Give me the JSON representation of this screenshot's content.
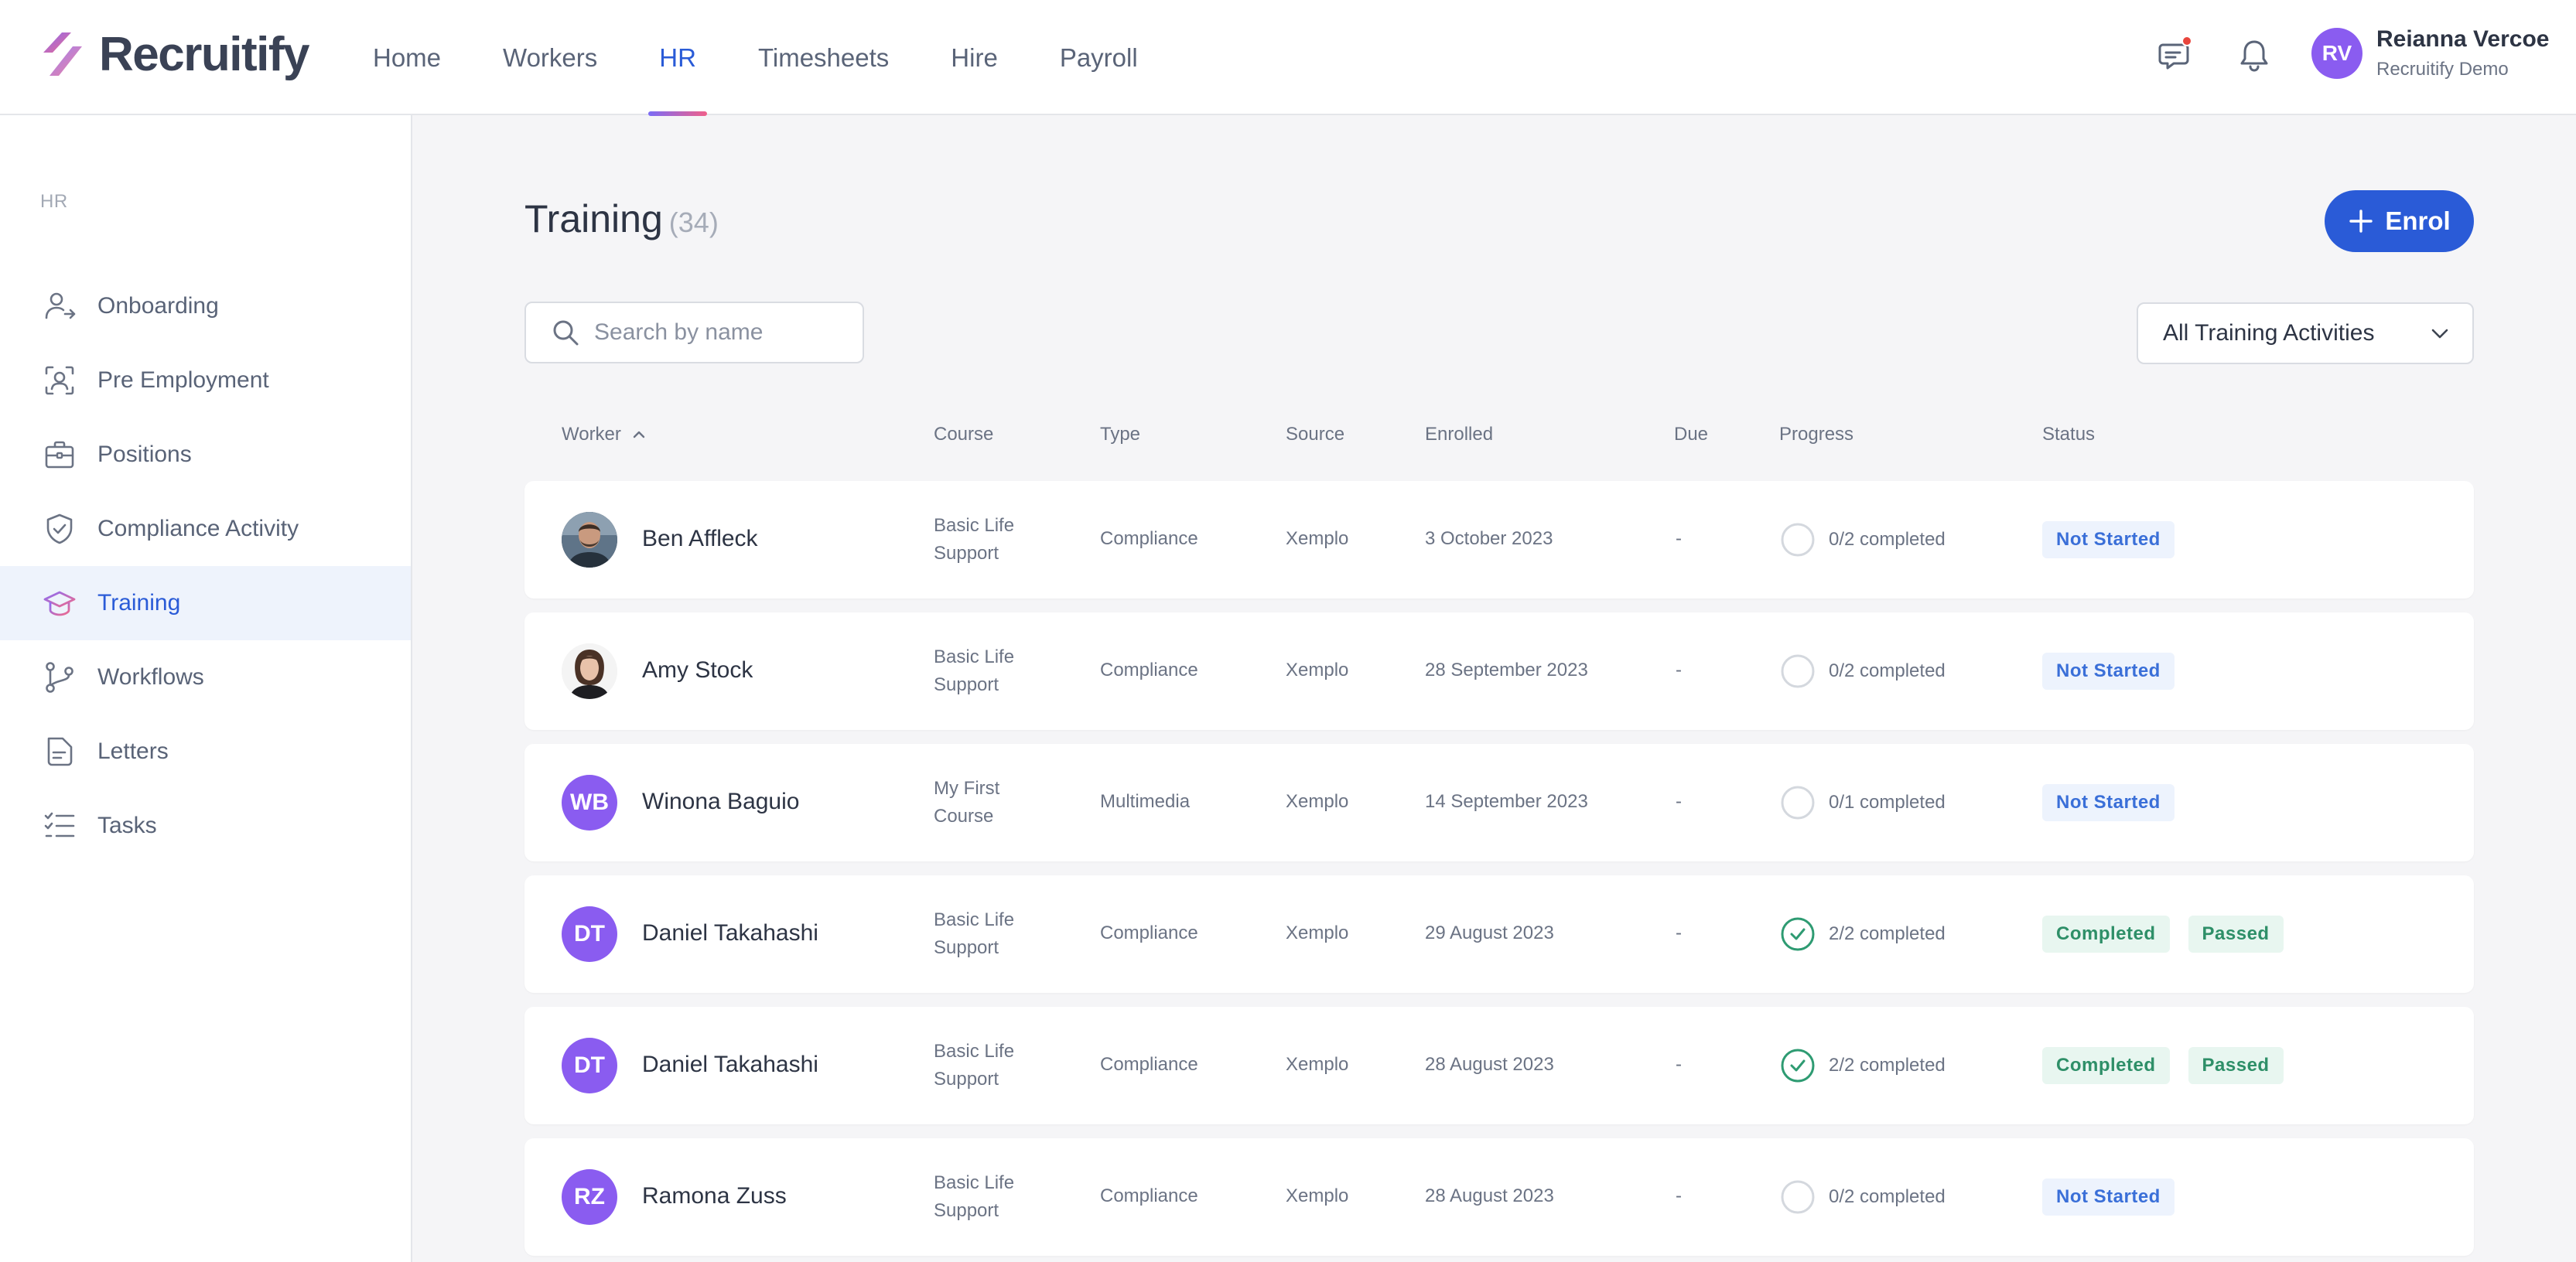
{
  "app": {
    "name": "Recruitify"
  },
  "nav": [
    {
      "label": "Home",
      "active": false
    },
    {
      "label": "Workers",
      "active": false
    },
    {
      "label": "HR",
      "active": true
    },
    {
      "label": "Timesheets",
      "active": false
    },
    {
      "label": "Hire",
      "active": false
    },
    {
      "label": "Payroll",
      "active": false
    }
  ],
  "user": {
    "initials": "RV",
    "name": "Reianna Vercoe",
    "org": "Recruitify Demo"
  },
  "sidebar": {
    "heading": "HR",
    "items": [
      {
        "label": "Onboarding",
        "icon": "user-arrow-icon"
      },
      {
        "label": "Pre Employment",
        "icon": "user-scan-icon"
      },
      {
        "label": "Positions",
        "icon": "briefcase-icon"
      },
      {
        "label": "Compliance Activity",
        "icon": "shield-check-icon"
      },
      {
        "label": "Training",
        "icon": "graduation-cap-icon",
        "active": true
      },
      {
        "label": "Workflows",
        "icon": "git-branch-icon"
      },
      {
        "label": "Letters",
        "icon": "document-icon"
      },
      {
        "label": "Tasks",
        "icon": "checklist-icon"
      }
    ]
  },
  "page": {
    "title": "Training",
    "count": "(34)"
  },
  "actions": {
    "enrol_label": "Enrol"
  },
  "search": {
    "placeholder": "Search by name",
    "value": ""
  },
  "filter": {
    "selected": "All Training Activities"
  },
  "table": {
    "columns": [
      "Worker",
      "Course",
      "Type",
      "Source",
      "Enrolled",
      "Due",
      "Progress",
      "Status"
    ],
    "sort": {
      "column": "Worker",
      "direction": "ascending"
    },
    "rows": [
      {
        "worker": "Ben Affleck",
        "avatar": "photo",
        "initials": "",
        "course": "Basic Life Support",
        "type": "Compliance",
        "source": "Xemplo",
        "enrolled": "3 October 2023",
        "due": "-",
        "progress": "0/2 completed",
        "complete": false,
        "status": [
          "Not Started"
        ]
      },
      {
        "worker": "Amy Stock",
        "avatar": "photo",
        "initials": "",
        "course": "Basic Life Support",
        "type": "Compliance",
        "source": "Xemplo",
        "enrolled": "28 September 2023",
        "due": "-",
        "progress": "0/2 completed",
        "complete": false,
        "status": [
          "Not Started"
        ]
      },
      {
        "worker": "Winona Baguio",
        "avatar": "initials",
        "initials": "WB",
        "course": "My First Course",
        "type": "Multimedia",
        "source": "Xemplo",
        "enrolled": "14 September 2023",
        "due": "-",
        "progress": "0/1 completed",
        "complete": false,
        "status": [
          "Not Started"
        ]
      },
      {
        "worker": "Daniel Takahashi",
        "avatar": "initials",
        "initials": "DT",
        "course": "Basic Life Support",
        "type": "Compliance",
        "source": "Xemplo",
        "enrolled": "29 August 2023",
        "due": "-",
        "progress": "2/2 completed",
        "complete": true,
        "status": [
          "Completed",
          "Passed"
        ]
      },
      {
        "worker": "Daniel Takahashi",
        "avatar": "initials",
        "initials": "DT",
        "course": "Basic Life Support",
        "type": "Compliance",
        "source": "Xemplo",
        "enrolled": "28 August 2023",
        "due": "-",
        "progress": "2/2 completed",
        "complete": true,
        "status": [
          "Completed",
          "Passed"
        ]
      },
      {
        "worker": "Ramona Zuss",
        "avatar": "initials",
        "initials": "RZ",
        "course": "Basic Life Support",
        "type": "Compliance",
        "source": "Xemplo",
        "enrolled": "28 August 2023",
        "due": "-",
        "progress": "0/2 completed",
        "complete": false,
        "status": [
          "Not Started"
        ]
      }
    ]
  },
  "colors": {
    "accent": "#2a5bd7",
    "avatar": "#8a5cf0",
    "success": "#2e8f68",
    "notice": "#e8453c"
  }
}
